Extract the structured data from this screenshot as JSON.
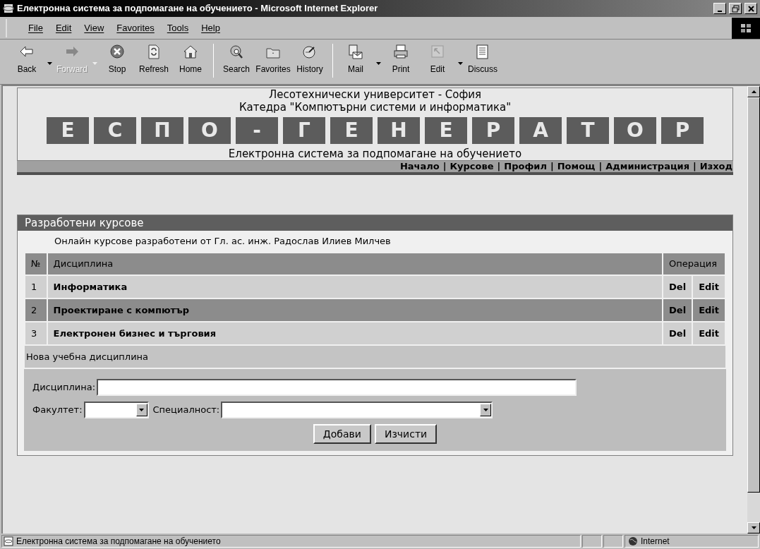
{
  "window": {
    "title": "Електронна система за подпомагане на обучението - Microsoft Internet Explorer"
  },
  "menu": [
    "File",
    "Edit",
    "View",
    "Favorites",
    "Tools",
    "Help"
  ],
  "toolbar": [
    {
      "label": "Back",
      "kind": "back",
      "disabled": false,
      "dropdown": true
    },
    {
      "label": "Forward",
      "kind": "forward",
      "disabled": true,
      "dropdown": true
    },
    {
      "label": "Stop",
      "kind": "stop",
      "disabled": false,
      "dropdown": false
    },
    {
      "label": "Refresh",
      "kind": "refresh",
      "disabled": false,
      "dropdown": false
    },
    {
      "label": "Home",
      "kind": "home",
      "disabled": false,
      "dropdown": false
    },
    {
      "label": "Search",
      "kind": "search",
      "disabled": false,
      "dropdown": false
    },
    {
      "label": "Favorites",
      "kind": "favorites",
      "disabled": false,
      "dropdown": false
    },
    {
      "label": "History",
      "kind": "history",
      "disabled": false,
      "dropdown": false
    },
    {
      "label": "Mail",
      "kind": "mail",
      "disabled": false,
      "dropdown": true
    },
    {
      "label": "Print",
      "kind": "print",
      "disabled": false,
      "dropdown": false
    },
    {
      "label": "Edit",
      "kind": "edit",
      "disabled": false,
      "dropdown": true
    },
    {
      "label": "Discuss",
      "kind": "discuss",
      "disabled": false,
      "dropdown": false
    }
  ],
  "header": {
    "university": "Лесотехнически университет - София",
    "department": "Катедра \"Компютърни системи и информатика\"",
    "logo_letters": [
      "Е",
      "С",
      "П",
      "О",
      "-",
      "Г",
      "Е",
      "Н",
      "Е",
      "Р",
      "А",
      "Т",
      "О",
      "Р"
    ],
    "subtitle": "Електронна система за подпомагане на обучението",
    "nav": [
      "Начало",
      "Курсове",
      "Профил",
      "Помощ",
      "Администрация",
      "Изход"
    ],
    "nav_separator": "|"
  },
  "panel": {
    "title": "Разработени курсове",
    "intro": "Онлайн курсове разработени от Гл. ас. инж. Радослав Илиев Милчев",
    "table": {
      "columns": [
        "№",
        "Дисциплина",
        "Операция"
      ],
      "rows": [
        {
          "number": "1",
          "name": "Информатика",
          "actions": [
            "Del",
            "Edit"
          ]
        },
        {
          "number": "2",
          "name": "Проектиране с компютър",
          "actions": [
            "Del",
            "Edit"
          ]
        },
        {
          "number": "3",
          "name": "Електронен бизнес и търговия",
          "actions": [
            "Del",
            "Edit"
          ]
        }
      ]
    },
    "new_section": "Нова учебна дисциплина",
    "form": {
      "discipline_label": "Дисциплина:",
      "faculty_label": "Факултет:",
      "specialty_label": "Специалност:",
      "buttons": [
        "Добави",
        "Изчисти"
      ]
    }
  },
  "status_bar": {
    "text": "Електронна система за подпомагане на обучението",
    "zone": "Internet"
  }
}
